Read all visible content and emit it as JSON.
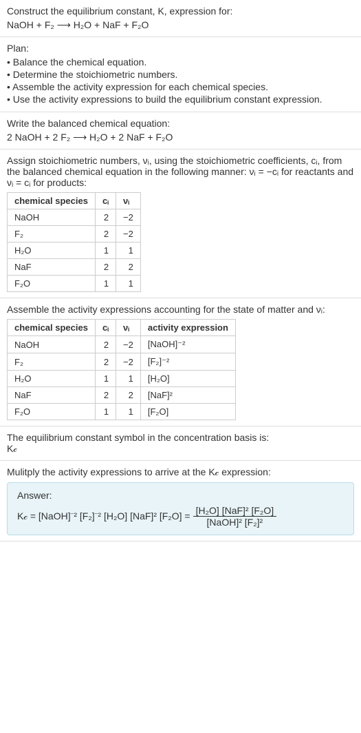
{
  "section1": {
    "line1": "Construct the equilibrium constant, K, expression for:",
    "equation": "NaOH + F₂ ⟶ H₂O + NaF + F₂O"
  },
  "section2": {
    "title": "Plan:",
    "items": [
      "• Balance the chemical equation.",
      "• Determine the stoichiometric numbers.",
      "• Assemble the activity expression for each chemical species.",
      "• Use the activity expressions to build the equilibrium constant expression."
    ]
  },
  "section3": {
    "title": "Write the balanced chemical equation:",
    "equation": "2 NaOH + 2 F₂ ⟶ H₂O + 2 NaF + F₂O"
  },
  "section4": {
    "text": "Assign stoichiometric numbers, νᵢ, using the stoichiometric coefficients, cᵢ, from the balanced chemical equation in the following manner: νᵢ = −cᵢ for reactants and νᵢ = cᵢ for products:",
    "headers": [
      "chemical species",
      "cᵢ",
      "νᵢ"
    ],
    "rows": [
      [
        "NaOH",
        "2",
        "−2"
      ],
      [
        "F₂",
        "2",
        "−2"
      ],
      [
        "H₂O",
        "1",
        "1"
      ],
      [
        "NaF",
        "2",
        "2"
      ],
      [
        "F₂O",
        "1",
        "1"
      ]
    ]
  },
  "section5": {
    "text": "Assemble the activity expressions accounting for the state of matter and νᵢ:",
    "headers": [
      "chemical species",
      "cᵢ",
      "νᵢ",
      "activity expression"
    ],
    "rows": [
      [
        "NaOH",
        "2",
        "−2",
        "[NaOH]⁻²"
      ],
      [
        "F₂",
        "2",
        "−2",
        "[F₂]⁻²"
      ],
      [
        "H₂O",
        "1",
        "1",
        "[H₂O]"
      ],
      [
        "NaF",
        "2",
        "2",
        "[NaF]²"
      ],
      [
        "F₂O",
        "1",
        "1",
        "[F₂O]"
      ]
    ]
  },
  "section6": {
    "line1": "The equilibrium constant symbol in the concentration basis is:",
    "symbol": "K𝒸"
  },
  "section7": {
    "text": "Mulitply the activity expressions to arrive at the K𝒸 expression:",
    "answer_label": "Answer:",
    "lhs": "K𝒸 = [NaOH]⁻² [F₂]⁻² [H₂O] [NaF]² [F₂O] = ",
    "frac_num": "[H₂O] [NaF]² [F₂O]",
    "frac_den": "[NaOH]² [F₂]²"
  },
  "chart_data": [
    {
      "type": "table",
      "title": "Stoichiometric numbers",
      "columns": [
        "chemical species",
        "c_i",
        "ν_i"
      ],
      "rows": [
        {
          "chemical species": "NaOH",
          "c_i": 2,
          "ν_i": -2
        },
        {
          "chemical species": "F₂",
          "c_i": 2,
          "ν_i": -2
        },
        {
          "chemical species": "H₂O",
          "c_i": 1,
          "ν_i": 1
        },
        {
          "chemical species": "NaF",
          "c_i": 2,
          "ν_i": 2
        },
        {
          "chemical species": "F₂O",
          "c_i": 1,
          "ν_i": 1
        }
      ]
    },
    {
      "type": "table",
      "title": "Activity expressions",
      "columns": [
        "chemical species",
        "c_i",
        "ν_i",
        "activity expression"
      ],
      "rows": [
        {
          "chemical species": "NaOH",
          "c_i": 2,
          "ν_i": -2,
          "activity expression": "[NaOH]^-2"
        },
        {
          "chemical species": "F₂",
          "c_i": 2,
          "ν_i": -2,
          "activity expression": "[F₂]^-2"
        },
        {
          "chemical species": "H₂O",
          "c_i": 1,
          "ν_i": 1,
          "activity expression": "[H₂O]"
        },
        {
          "chemical species": "NaF",
          "c_i": 2,
          "ν_i": 2,
          "activity expression": "[NaF]^2"
        },
        {
          "chemical species": "F₂O",
          "c_i": 1,
          "ν_i": 1,
          "activity expression": "[F₂O]"
        }
      ]
    }
  ]
}
